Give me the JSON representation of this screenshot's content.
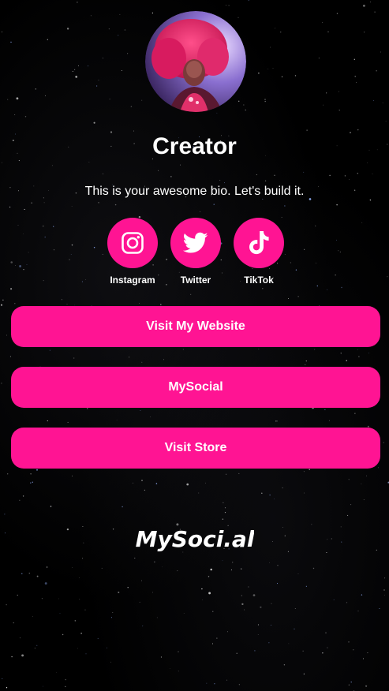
{
  "profile": {
    "name": "Creator",
    "bio": "This is your awesome bio. Let's build it."
  },
  "socials": [
    {
      "label": "Instagram",
      "icon": "instagram-icon"
    },
    {
      "label": "Twitter",
      "icon": "twitter-icon"
    },
    {
      "label": "TikTok",
      "icon": "tiktok-icon"
    }
  ],
  "links": [
    {
      "label": "Visit My Website"
    },
    {
      "label": "MySocial"
    },
    {
      "label": "Visit Store"
    }
  ],
  "brand": {
    "logo_text": "MySoci.al"
  },
  "colors": {
    "accent": "#ff1493",
    "background": "#000000",
    "text": "#ffffff",
    "logo_dot": "#5b6cf0"
  }
}
